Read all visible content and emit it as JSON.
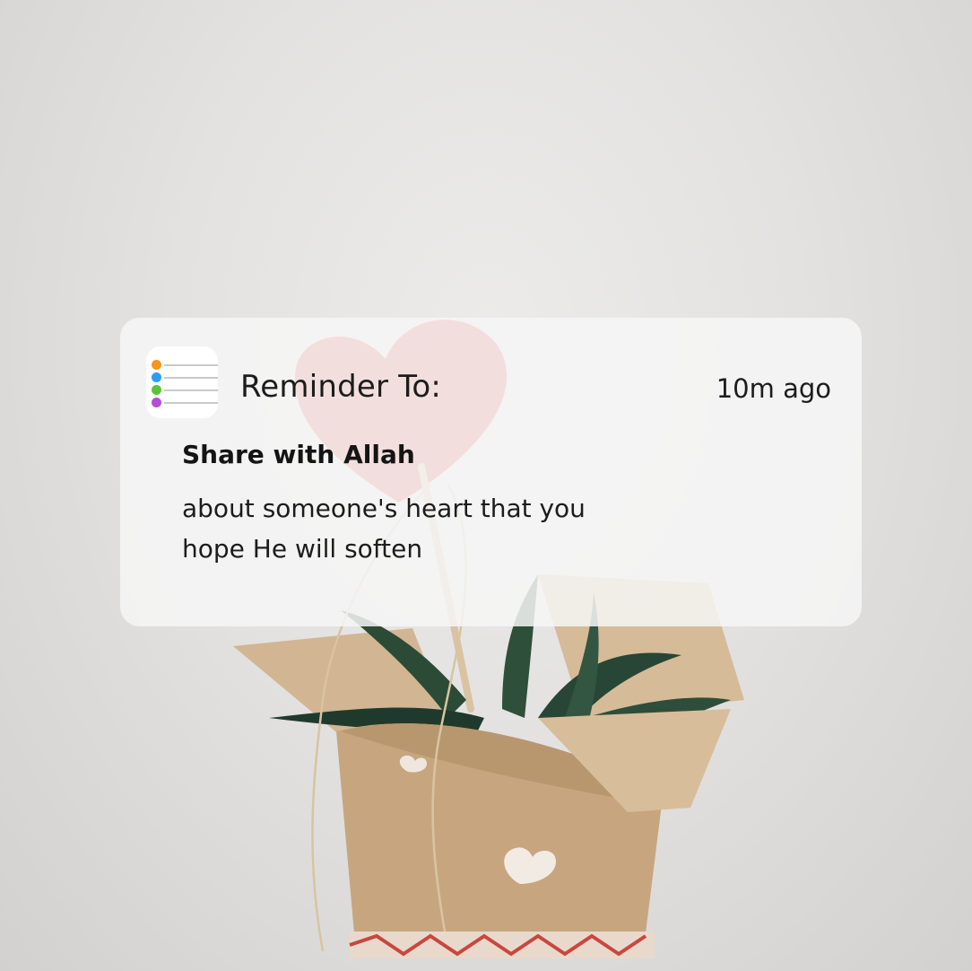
{
  "notification": {
    "title": "Reminder To:",
    "time": "10m ago",
    "headline": "Share with Allah",
    "body": "about someone's heart that you hope He will soften"
  },
  "app_icon": {
    "name": "reminders-app-icon",
    "dot_colors": [
      "#f7941d",
      "#2d9cf4",
      "#57c638",
      "#b04fd8"
    ]
  },
  "background": {
    "description_colors": {
      "wall": "#e6e5e4",
      "heart": "#e85a5a",
      "paper": "#c9a882",
      "leaves": "#2f4a38"
    }
  }
}
